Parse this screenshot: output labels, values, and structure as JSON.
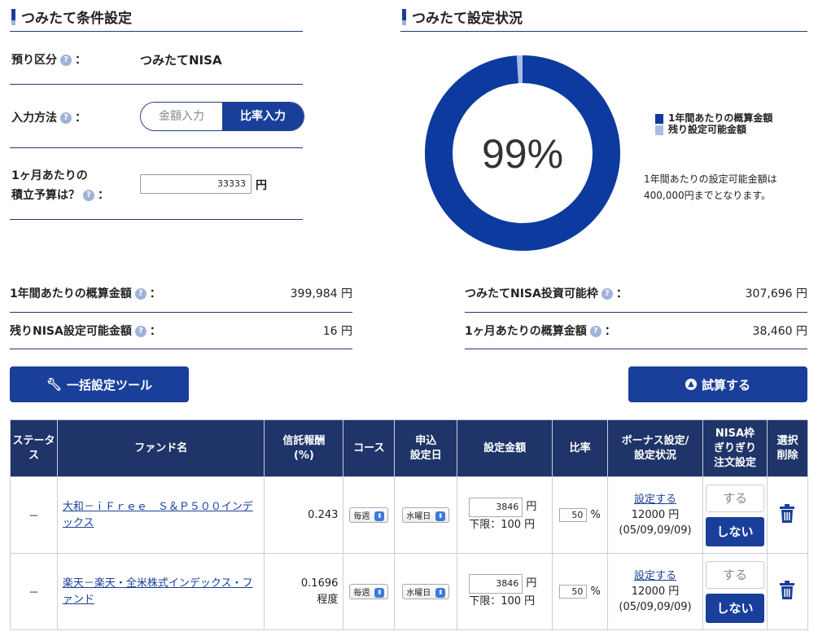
{
  "left_section": {
    "title": "つみたて条件設定",
    "account_type": {
      "label": "預り区分",
      "value": "つみたてNISA"
    },
    "input_method": {
      "label": "入力方法",
      "option_amount": "金額入力",
      "option_ratio": "比率入力"
    },
    "budget": {
      "label_line1": "1ヶ月あたりの",
      "label_line2": "積立予算は？",
      "value": "33333",
      "unit": "円"
    }
  },
  "right_section": {
    "title": "つみたて設定状況",
    "percent": "99%",
    "usage_fraction": 0.99,
    "legend_used": "1年間あたりの概算金額",
    "legend_remaining": "残り設定可能金額",
    "note_line1": "1年間あたりの設定可能金額は",
    "note_line2": "400,000円までとなります。",
    "colors": {
      "used": "#0d3a9e",
      "remaining": "#a7bce8"
    }
  },
  "amounts": {
    "annual_estimate": {
      "label": "1年間あたりの概算金額",
      "value": "399,984",
      "unit": "円"
    },
    "remaining_nisa": {
      "label": "残りNISA設定可能金額",
      "value": "16",
      "unit": "円"
    },
    "nisa_limit": {
      "label": "つみたてNISA投資可能枠",
      "value": "307,696",
      "unit": "円"
    },
    "monthly_estimate": {
      "label": "1ヶ月あたりの概算金額",
      "value": "38,460",
      "unit": "円"
    }
  },
  "buttons": {
    "bulk_tool": "一括設定ツール",
    "simulate": "試算する"
  },
  "table": {
    "headers": {
      "status": "ステータス",
      "fund": "ファンド名",
      "fee_1": "信託報酬",
      "fee_2": "(%)",
      "course": "コース",
      "date_1": "申込",
      "date_2": "設定日",
      "amount": "設定金額",
      "ratio": "比率",
      "bonus_1": "ボーナス設定/",
      "bonus_2": "設定状況",
      "nisa_1": "NISA枠",
      "nisa_2": "ぎりぎり",
      "nisa_3": "注文設定",
      "del_1": "選択",
      "del_2": "削除"
    },
    "rows": [
      {
        "status": "－",
        "fund": "大和－ｉＦｒｅｅ　Ｓ＆Ｐ５００インデックス",
        "fee": "0.243",
        "fee_note": "",
        "course": "毎週",
        "day": "水曜日",
        "amount": "3846",
        "amount_unit": "円",
        "min": "下限：100 円",
        "ratio": "50",
        "ratio_unit": "%",
        "bonus_link": "設定する",
        "bonus_amount": "12000 円",
        "bonus_dates": "(05/09,09/09)",
        "suru": "する",
        "shinai": "しない"
      },
      {
        "status": "－",
        "fund": "楽天－楽天・全米株式インデックス・ファンド",
        "fee": "0.1696",
        "fee_note": "程度",
        "course": "毎週",
        "day": "水曜日",
        "amount": "3846",
        "amount_unit": "円",
        "min": "下限：100 円",
        "ratio": "50",
        "ratio_unit": "%",
        "bonus_link": "設定する",
        "bonus_amount": "12000 円",
        "bonus_dates": "(05/09,09/09)",
        "suru": "する",
        "shinai": "しない"
      }
    ]
  }
}
